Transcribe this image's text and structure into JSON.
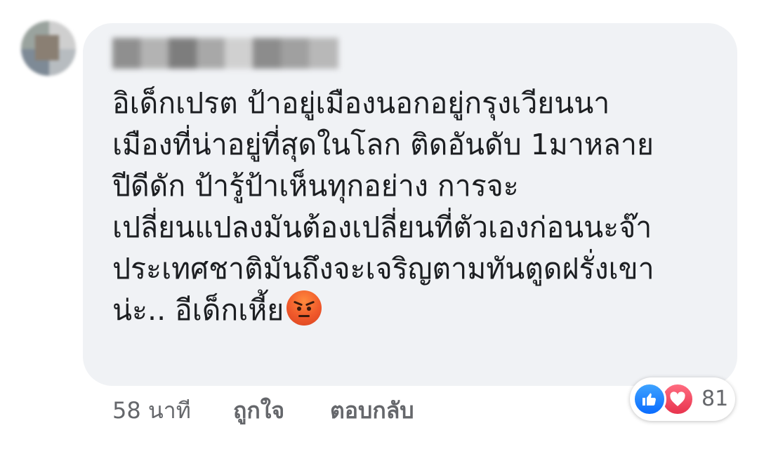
{
  "comment": {
    "author": "",
    "lines": [
      "อิเด็กเปรต ป้าอยู่เมืองนอกอยู่กรุงเวียนนา",
      "เมืองที่น่าอยู่ที่สุดในโลก ติดอันดับ 1มาหลาย",
      "ปีดีดัก ป้ารู้ป้าเห็นทุกอย่าง การจะ",
      "เปลี่ยนแปลงมันต้องเปลี่ยนที่ตัวเองก่อนนะจ๊า",
      "ประเทศชาติมันถึงจะเจริญตามทันตูดฝรั่งเขา",
      "น่ะ.. อีเด็กเหี้ย"
    ],
    "emoji": "angry-face-icon"
  },
  "actions": {
    "timestamp": "58 นาที",
    "like_label": "ถูกใจ",
    "reply_label": "ตอบกลับ"
  },
  "reactions": {
    "icons": [
      "like-icon",
      "love-icon"
    ],
    "count": "81"
  },
  "colors": {
    "bubble": "#f0f2f5",
    "text": "#1c1e21",
    "meta": "#65676b",
    "like": "#1877f2",
    "love": "#f33e58"
  }
}
